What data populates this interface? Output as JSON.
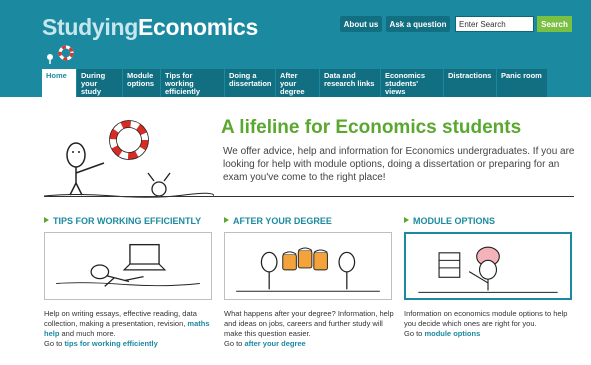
{
  "site": {
    "logo_light": "Studying",
    "logo_bold": "Economics"
  },
  "header": {
    "about_label": "About us",
    "ask_label": "Ask a question",
    "search_value": "Enter Search",
    "search_button": "Search"
  },
  "nav": [
    {
      "label": "Home",
      "active": true
    },
    {
      "label": "During your study"
    },
    {
      "label": "Module options"
    },
    {
      "label": "Tips for working efficiently"
    },
    {
      "label": "Doing a dissertation"
    },
    {
      "label": "After your degree"
    },
    {
      "label": "Data and research links"
    },
    {
      "label": "Economics students' views"
    },
    {
      "label": "Distractions"
    },
    {
      "label": "Panic room"
    }
  ],
  "hero": {
    "title": "A lifeline for Economics students",
    "text": "We offer advice, help and information for Economics undergraduates. If you are looking for help with module options, doing a dissertation or preparing for an exam you've come to the right place!"
  },
  "sections": [
    {
      "heading": "TIPS FOR WORKING EFFICIENTLY",
      "desc_pre": "Help on writing essays, effective reading, data collection, making a presentation, revision, ",
      "desc_link": "maths help",
      "desc_post": " and much more.",
      "goto_prefix": "Go to ",
      "goto_link": "tips for working efficiently"
    },
    {
      "heading": "AFTER YOUR DEGREE",
      "desc_pre": "What happens after your degree? Information, help and ideas on jobs, careers and further study will make this question easier.",
      "goto_prefix": "Go to ",
      "goto_link": "after your degree"
    },
    {
      "heading": "MODULE OPTIONS",
      "desc_pre": "Information on economics module options to help you decide which ones are right for you.",
      "goto_prefix": "Go to ",
      "goto_link": "module options"
    }
  ],
  "colors": {
    "header_teal": "#1b8aa0",
    "nav_dark": "#126f82",
    "accent_green": "#5aa830",
    "search_green": "#7ac043"
  }
}
